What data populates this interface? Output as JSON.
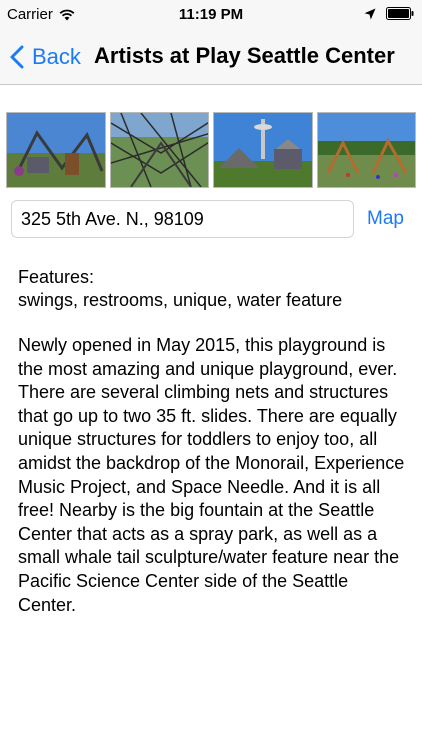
{
  "status_bar": {
    "carrier": "Carrier",
    "time": "11:19 PM",
    "icons": [
      "wifi-icon",
      "location-arrow-icon",
      "battery-icon"
    ]
  },
  "nav": {
    "back_label": "Back",
    "title": "Artists at Play Seattle Center",
    "accent_color": "#1a7cf5"
  },
  "gallery": {
    "photos": [
      {
        "name": "playground-photo-1"
      },
      {
        "name": "playground-photo-2"
      },
      {
        "name": "playground-photo-3"
      },
      {
        "name": "playground-photo-4"
      }
    ]
  },
  "address": {
    "value": "325 5th Ave. N., 98109",
    "map_label": "Map"
  },
  "features": {
    "heading": "Features:",
    "list": "swings, restrooms, unique, water feature"
  },
  "description": "Newly opened in May 2015, this playground is the most amazing and unique playground, ever. There are several climbing nets and structures that go up to two 35 ft. slides. There are equally unique structures for toddlers to enjoy too, all amidst the backdrop of the Monorail, Experience Music Project, and Space Needle. And it is all free! Nearby is the big fountain at the Seattle Center that acts as a spray park, as well as a small whale tail sculpture/water feature near the Pacific Science Center side of the Seattle Center."
}
